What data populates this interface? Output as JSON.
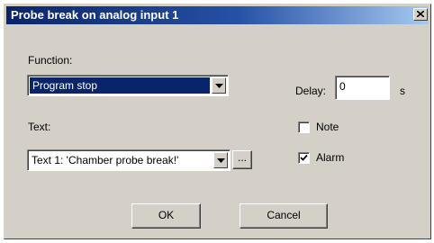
{
  "window": {
    "title": "Probe break on analog input 1"
  },
  "function": {
    "label": "Function:",
    "selected": "Program stop"
  },
  "delay": {
    "label": "Delay:",
    "value": "0",
    "unit": "s"
  },
  "text": {
    "label": "Text:",
    "selected": "Text 1: 'Chamber probe break!'",
    "browse_label": "..."
  },
  "note": {
    "label": "Note",
    "checked": false
  },
  "alarm": {
    "label": "Alarm",
    "checked": true
  },
  "buttons": {
    "ok": "OK",
    "cancel": "Cancel"
  },
  "icons": {
    "close": "close-icon",
    "dropdown": "chevron-down-icon",
    "check": "checkmark-icon"
  },
  "colors": {
    "face": "#d4d0c8",
    "title_start": "#0a246a",
    "title_end": "#a6caf0",
    "selection": "#0a246a"
  }
}
